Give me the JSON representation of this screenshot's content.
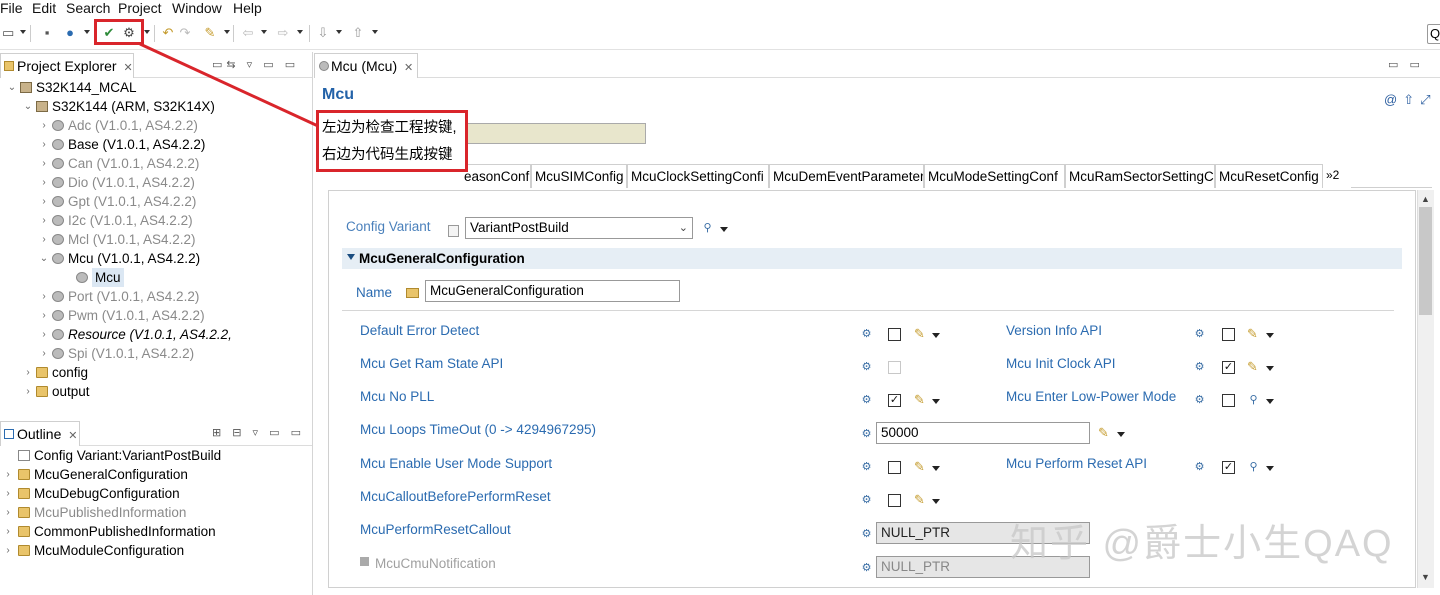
{
  "menubar": {
    "items": [
      "File",
      "Edit",
      "Search",
      "Project",
      "Window",
      "Help"
    ]
  },
  "toolbar": {
    "search_icon": "search-icon"
  },
  "project_explorer": {
    "title": "Project Explorer",
    "tree": [
      {
        "label": "S32K144_MCAL",
        "level": 0,
        "icon": "project",
        "expanded": true
      },
      {
        "label": "S32K144 (ARM, S32K14X)",
        "level": 1,
        "icon": "chip",
        "expanded": true
      },
      {
        "label": "Adc (V1.0.1, AS4.2.2)",
        "level": 2,
        "icon": "gear",
        "gray": true
      },
      {
        "label": "Base (V1.0.1, AS4.2.2)",
        "level": 2,
        "icon": "gear"
      },
      {
        "label": "Can (V1.0.1, AS4.2.2)",
        "level": 2,
        "icon": "gear",
        "gray": true
      },
      {
        "label": "Dio (V1.0.1, AS4.2.2)",
        "level": 2,
        "icon": "gear",
        "gray": true
      },
      {
        "label": "Gpt (V1.0.1, AS4.2.2)",
        "level": 2,
        "icon": "gear",
        "gray": true
      },
      {
        "label": "I2c (V1.0.1, AS4.2.2)",
        "level": 2,
        "icon": "gear",
        "gray": true
      },
      {
        "label": "Mcl (V1.0.1, AS4.2.2)",
        "level": 2,
        "icon": "gear",
        "gray": true
      },
      {
        "label": "Mcu (V1.0.1, AS4.2.2)",
        "level": 2,
        "icon": "gear",
        "expanded": true
      },
      {
        "label": "Mcu",
        "level": 3,
        "icon": "gear",
        "selected": true
      },
      {
        "label": "Port (V1.0.1, AS4.2.2)",
        "level": 2,
        "icon": "gear",
        "gray": true
      },
      {
        "label": "Pwm (V1.0.1, AS4.2.2)",
        "level": 2,
        "icon": "gear",
        "gray": true
      },
      {
        "label": "Resource (V1.0.1, AS4.2.2,",
        "level": 2,
        "icon": "gear",
        "italic": true
      },
      {
        "label": "Spi (V1.0.1, AS4.2.2)",
        "level": 2,
        "icon": "gear",
        "gray": true
      },
      {
        "label": "config",
        "level": 1,
        "icon": "folder"
      },
      {
        "label": "output",
        "level": 1,
        "icon": "folder"
      }
    ]
  },
  "outline": {
    "title": "Outline",
    "tree": [
      {
        "label": "Config Variant:VariantPostBuild",
        "icon": "doc"
      },
      {
        "label": "McuGeneralConfiguration",
        "icon": "folder"
      },
      {
        "label": "McuDebugConfiguration",
        "icon": "folder"
      },
      {
        "label": "McuPublishedInformation",
        "icon": "folder",
        "gray": true
      },
      {
        "label": "CommonPublishedInformation",
        "icon": "folder"
      },
      {
        "label": "McuModuleConfiguration",
        "icon": "folder"
      }
    ]
  },
  "editor": {
    "tab_label": "Mcu (Mcu)",
    "title": "Mcu",
    "tabs": [
      "easonConf",
      "McuSIMConfig",
      "McuClockSettingConfi",
      "McuDemEventParameter",
      "McuModeSettingConf",
      "McuRamSectorSettingC",
      "McuResetConfig"
    ],
    "tabs_overflow": "»2",
    "config_variant_label": "Config Variant",
    "config_variant_value": "VariantPostBuild",
    "section_title": "McuGeneralConfiguration",
    "name_label": "Name",
    "name_value": "McuGeneralConfiguration",
    "fields": {
      "default_error_detect": "Default Error Detect",
      "version_info_api": "Version Info API",
      "get_ram_state_api": "Mcu Get Ram State API",
      "init_clock_api": "Mcu Init Clock API",
      "no_pll": "Mcu No PLL",
      "enter_low_power": "Mcu Enter Low-Power Mode",
      "loops_timeout": "Mcu Loops TimeOut (0 -> 4294967295)",
      "loops_timeout_value": "50000",
      "enable_user_mode": "Mcu Enable User Mode Support",
      "perform_reset_api": "Mcu Perform Reset API",
      "callout_before_reset": "McuCalloutBeforePerformReset",
      "perform_reset_callout": "McuPerformResetCallout",
      "perform_reset_callout_value": "NULL_PTR",
      "cmu_notification": "McuCmuNotification",
      "cmu_notification_value": "NULL_PTR"
    },
    "checks": {
      "default_error_detect": false,
      "version_info_api": false,
      "get_ram_state_api": false,
      "init_clock_api": true,
      "no_pll": true,
      "enter_low_power": false,
      "enable_user_mode": false,
      "perform_reset_api": true,
      "callout_before_reset": false
    }
  },
  "annotation": {
    "line1": "左边为检查工程按键,",
    "line2": "右边为代码生成按键"
  },
  "watermark": "知乎 @爵士小生QAQ",
  "colors": {
    "link_blue": "#2b6bb0",
    "title_blue": "#2362a8",
    "callout_red": "#d9252b"
  }
}
